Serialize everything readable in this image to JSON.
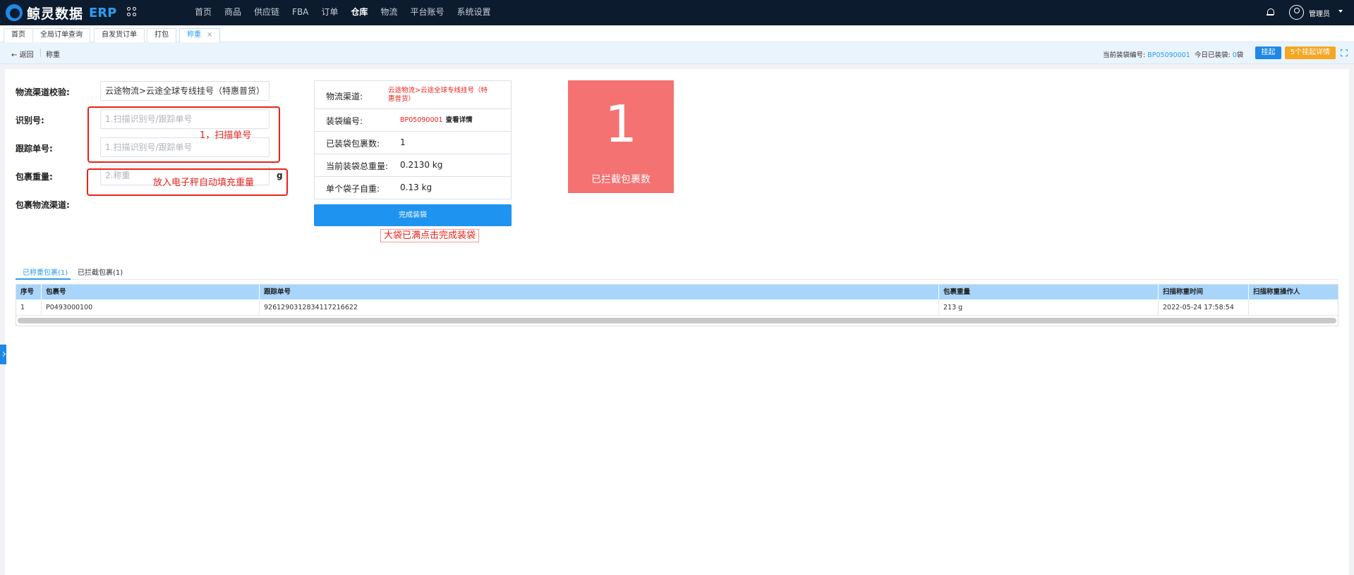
{
  "app": {
    "logo_text": "鲸灵数据",
    "logo_suffix": "ERP"
  },
  "nav": [
    {
      "label": "首页"
    },
    {
      "label": "商品"
    },
    {
      "label": "供应链"
    },
    {
      "label": "FBA"
    },
    {
      "label": "订单"
    },
    {
      "label": "仓库",
      "active": true
    },
    {
      "label": "物流"
    },
    {
      "label": "平台账号"
    },
    {
      "label": "系统设置"
    }
  ],
  "user": {
    "name": "管理员"
  },
  "tabs": [
    {
      "label": "首页"
    },
    {
      "label": "全局订单查询"
    },
    {
      "label": "自发货订单"
    },
    {
      "label": "打包"
    },
    {
      "label": "称重",
      "active": true,
      "close": "×"
    }
  ],
  "subbar": {
    "back_label": "返回",
    "crumb": "称重",
    "bag_no_label": "当前装袋编号:",
    "bag_no_value": "BP05090001",
    "today_label": "今日已装袋:",
    "today_value": "0",
    "today_unit": "袋",
    "hang_button": "挂起",
    "hang_detail_button": "5个挂起详情"
  },
  "form": {
    "channel_check_label": "物流渠道校验:",
    "channel_check_value": "云途物流>云途全球专线挂号（特惠普货）",
    "id_label": "识别号:",
    "id_placeholder": "1.扫描识别号/跟踪单号",
    "tracking_label": "跟踪单号:",
    "tracking_placeholder": "1.扫描识别号/跟踪单号",
    "weight_label": "包裹重量:",
    "weight_placeholder": "2.称重",
    "weight_unit": "g",
    "pkg_channel_label": "包裹物流渠道:"
  },
  "annotations": {
    "scan": "1，扫描单号",
    "scale": "放入电子秤自动填充重量",
    "finish": "大袋已满点击完成装袋"
  },
  "info": {
    "channel_label": "物流渠道:",
    "channel_value_line1": "云途物流>云途全球专线挂号（特",
    "channel_value_line2": "惠普货）",
    "bag_no_label": "装袋编号:",
    "bag_no_value": "BP05090001",
    "bag_no_link": "查看详情",
    "count_label": "已装袋包裹数:",
    "count_value": "1",
    "total_weight_label": "当前装袋总重量:",
    "total_weight_value": "0.2130 kg",
    "bag_weight_label": "单个袋子自重:",
    "bag_weight_value": "0.13 kg"
  },
  "finish_button": "完成装袋",
  "intercept": {
    "count": "1",
    "label": "已拦截包裹数"
  },
  "lower_tabs": [
    {
      "label": "已称重包裹(1)",
      "active": true
    },
    {
      "label": "已拦截包裹(1)"
    }
  ],
  "grid": {
    "columns": [
      "序号",
      "包裹号",
      "跟踪单号",
      "包裹重量",
      "扫描称重时间",
      "扫描称重操作人"
    ],
    "rows": [
      [
        "1",
        "P0493000100",
        "92612903128341172166​22",
        "213 g",
        "2022-05-24 17:58:54",
        ""
      ]
    ]
  }
}
